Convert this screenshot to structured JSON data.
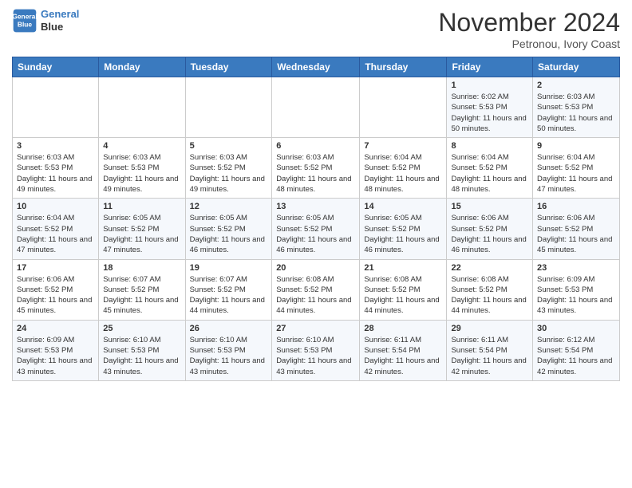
{
  "header": {
    "logo_line1": "General",
    "logo_line2": "Blue",
    "month": "November 2024",
    "location": "Petronou, Ivory Coast"
  },
  "days_of_week": [
    "Sunday",
    "Monday",
    "Tuesday",
    "Wednesday",
    "Thursday",
    "Friday",
    "Saturday"
  ],
  "weeks": [
    [
      {
        "day": "",
        "info": ""
      },
      {
        "day": "",
        "info": ""
      },
      {
        "day": "",
        "info": ""
      },
      {
        "day": "",
        "info": ""
      },
      {
        "day": "",
        "info": ""
      },
      {
        "day": "1",
        "info": "Sunrise: 6:02 AM\nSunset: 5:53 PM\nDaylight: 11 hours\nand 50 minutes."
      },
      {
        "day": "2",
        "info": "Sunrise: 6:03 AM\nSunset: 5:53 PM\nDaylight: 11 hours\nand 50 minutes."
      }
    ],
    [
      {
        "day": "3",
        "info": "Sunrise: 6:03 AM\nSunset: 5:53 PM\nDaylight: 11 hours\nand 49 minutes."
      },
      {
        "day": "4",
        "info": "Sunrise: 6:03 AM\nSunset: 5:53 PM\nDaylight: 11 hours\nand 49 minutes."
      },
      {
        "day": "5",
        "info": "Sunrise: 6:03 AM\nSunset: 5:52 PM\nDaylight: 11 hours\nand 49 minutes."
      },
      {
        "day": "6",
        "info": "Sunrise: 6:03 AM\nSunset: 5:52 PM\nDaylight: 11 hours\nand 48 minutes."
      },
      {
        "day": "7",
        "info": "Sunrise: 6:04 AM\nSunset: 5:52 PM\nDaylight: 11 hours\nand 48 minutes."
      },
      {
        "day": "8",
        "info": "Sunrise: 6:04 AM\nSunset: 5:52 PM\nDaylight: 11 hours\nand 48 minutes."
      },
      {
        "day": "9",
        "info": "Sunrise: 6:04 AM\nSunset: 5:52 PM\nDaylight: 11 hours\nand 47 minutes."
      }
    ],
    [
      {
        "day": "10",
        "info": "Sunrise: 6:04 AM\nSunset: 5:52 PM\nDaylight: 11 hours\nand 47 minutes."
      },
      {
        "day": "11",
        "info": "Sunrise: 6:05 AM\nSunset: 5:52 PM\nDaylight: 11 hours\nand 47 minutes."
      },
      {
        "day": "12",
        "info": "Sunrise: 6:05 AM\nSunset: 5:52 PM\nDaylight: 11 hours\nand 46 minutes."
      },
      {
        "day": "13",
        "info": "Sunrise: 6:05 AM\nSunset: 5:52 PM\nDaylight: 11 hours\nand 46 minutes."
      },
      {
        "day": "14",
        "info": "Sunrise: 6:05 AM\nSunset: 5:52 PM\nDaylight: 11 hours\nand 46 minutes."
      },
      {
        "day": "15",
        "info": "Sunrise: 6:06 AM\nSunset: 5:52 PM\nDaylight: 11 hours\nand 46 minutes."
      },
      {
        "day": "16",
        "info": "Sunrise: 6:06 AM\nSunset: 5:52 PM\nDaylight: 11 hours\nand 45 minutes."
      }
    ],
    [
      {
        "day": "17",
        "info": "Sunrise: 6:06 AM\nSunset: 5:52 PM\nDaylight: 11 hours\nand 45 minutes."
      },
      {
        "day": "18",
        "info": "Sunrise: 6:07 AM\nSunset: 5:52 PM\nDaylight: 11 hours\nand 45 minutes."
      },
      {
        "day": "19",
        "info": "Sunrise: 6:07 AM\nSunset: 5:52 PM\nDaylight: 11 hours\nand 44 minutes."
      },
      {
        "day": "20",
        "info": "Sunrise: 6:08 AM\nSunset: 5:52 PM\nDaylight: 11 hours\nand 44 minutes."
      },
      {
        "day": "21",
        "info": "Sunrise: 6:08 AM\nSunset: 5:52 PM\nDaylight: 11 hours\nand 44 minutes."
      },
      {
        "day": "22",
        "info": "Sunrise: 6:08 AM\nSunset: 5:52 PM\nDaylight: 11 hours\nand 44 minutes."
      },
      {
        "day": "23",
        "info": "Sunrise: 6:09 AM\nSunset: 5:53 PM\nDaylight: 11 hours\nand 43 minutes."
      }
    ],
    [
      {
        "day": "24",
        "info": "Sunrise: 6:09 AM\nSunset: 5:53 PM\nDaylight: 11 hours\nand 43 minutes."
      },
      {
        "day": "25",
        "info": "Sunrise: 6:10 AM\nSunset: 5:53 PM\nDaylight: 11 hours\nand 43 minutes."
      },
      {
        "day": "26",
        "info": "Sunrise: 6:10 AM\nSunset: 5:53 PM\nDaylight: 11 hours\nand 43 minutes."
      },
      {
        "day": "27",
        "info": "Sunrise: 6:10 AM\nSunset: 5:53 PM\nDaylight: 11 hours\nand 43 minutes."
      },
      {
        "day": "28",
        "info": "Sunrise: 6:11 AM\nSunset: 5:54 PM\nDaylight: 11 hours\nand 42 minutes."
      },
      {
        "day": "29",
        "info": "Sunrise: 6:11 AM\nSunset: 5:54 PM\nDaylight: 11 hours\nand 42 minutes."
      },
      {
        "day": "30",
        "info": "Sunrise: 6:12 AM\nSunset: 5:54 PM\nDaylight: 11 hours\nand 42 minutes."
      }
    ]
  ]
}
